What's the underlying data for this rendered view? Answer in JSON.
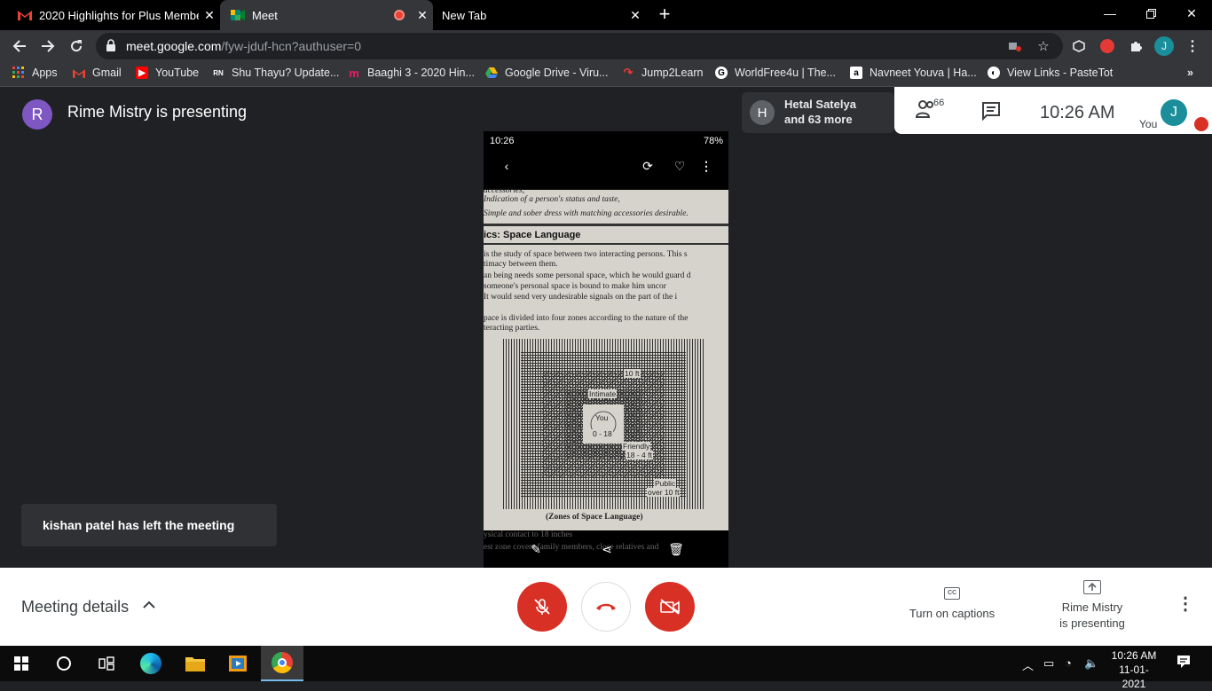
{
  "tabs": [
    {
      "title": "2020 Highlights for Plus Member",
      "favicon": "gmail-icon",
      "active": false
    },
    {
      "title": "Meet",
      "favicon": "meet-icon",
      "active": true
    },
    {
      "title": "New Tab",
      "favicon": "",
      "active": false
    }
  ],
  "address": {
    "host": "meet.google.com",
    "path": "/fyw-jduf-hcn?authuser=0"
  },
  "profile_initial": "J",
  "bookmarks": [
    {
      "label": "Apps",
      "icon": "apps-grid-icon"
    },
    {
      "label": "Gmail",
      "icon": "gmail-icon"
    },
    {
      "label": "YouTube",
      "icon": "youtube-icon"
    },
    {
      "label": "Shu Thayu? Update...",
      "icon": "rn-icon"
    },
    {
      "label": "Baaghi 3 - 2020 Hin...",
      "icon": "m-icon"
    },
    {
      "label": "Google Drive - Viru...",
      "icon": "drive-icon"
    },
    {
      "label": "Jump2Learn",
      "icon": "jump2learn-icon"
    },
    {
      "label": "WorldFree4u | The...",
      "icon": "g-icon"
    },
    {
      "label": "Navneet Youva | Ha...",
      "icon": "amazon-icon"
    },
    {
      "label": "View Links - PasteTot",
      "icon": "globe-icon"
    }
  ],
  "meeting": {
    "presenter_initial": "R",
    "presenting_title": "Rime Mistry is presenting",
    "participant_chip": {
      "initial": "H",
      "name": "Hetal Satelya",
      "more": "and 63 more"
    },
    "people_count": "66",
    "time": "10:26  AM",
    "you_label": "You",
    "you_initial": "J",
    "toast": "kishan patel has left the meeting"
  },
  "shared_screen": {
    "status_time": "10:26",
    "status_right": "78%",
    "lines_top": [
      "accessories,",
      "Indication of a person's status and taste,",
      "Simple and sober dress with matching accessories desirable."
    ],
    "heading": "ics: Space Language",
    "para1": [
      "is the study of space between two interacting persons. This s",
      "timacy between them."
    ],
    "para2": [
      "an being needs some personal space, which he would guard d",
      "someone's personal space is bound to make him uncor",
      "It would send very undesirable signals on the part of the i"
    ],
    "para3": [
      "pace is divided into four zones according to the nature of the",
      "teracting parties."
    ],
    "zones": {
      "intimate": "Intimate",
      "you": "You",
      "intimate_range": "0 - 18",
      "personal_range": "10 ft",
      "friendly": "Friendly",
      "friendly_range": "18 - 4 ft",
      "public": "Public",
      "public_range": "over 10 ft"
    },
    "caption": "(Zones of Space Language)",
    "bottom_lines": [
      "ysical contact to 18 inches",
      "est zone covers family members, close relatives and"
    ]
  },
  "bottom": {
    "meeting_details": "Meeting details",
    "captions": "Turn on captions",
    "presenting_line1": "Rime Mistry",
    "presenting_line2": "is presenting"
  },
  "taskbar": {
    "time": "10:26 AM",
    "date": "11-01-2021"
  }
}
